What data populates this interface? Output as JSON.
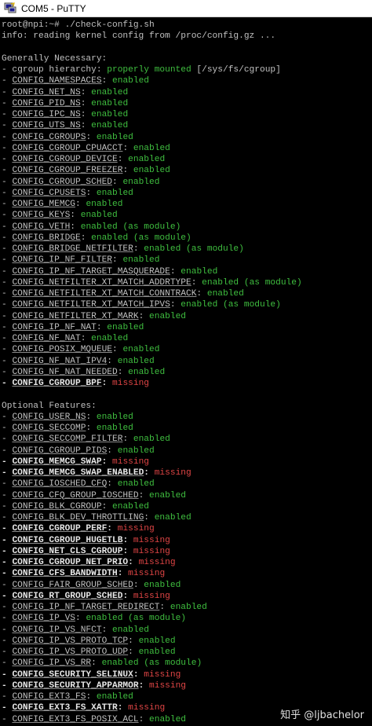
{
  "window": {
    "title": "COM5 - PuTTY",
    "icon": "putty-icon"
  },
  "terminal": {
    "colors": {
      "background": "#000000",
      "text": "#c0c0c0",
      "enabled": "#3fbf3f",
      "missing": "#e04545"
    },
    "lines": [
      {
        "text": "root@npi:~# ./check-config.sh"
      },
      {
        "text": "info: reading kernel config from /proc/config.gz ..."
      },
      {
        "text": ""
      },
      {
        "text": "Generally Necessary:"
      },
      {
        "prefix": "- cgroup hierarchy: ",
        "status": "properly mounted",
        "suffix": " [/sys/fs/cgroup]",
        "state": "ok"
      },
      {
        "prefix": "- ",
        "name": "CONFIG_NAMESPACES",
        "sep": ": ",
        "status": "enabled",
        "state": "ok"
      },
      {
        "prefix": "- ",
        "name": "CONFIG_NET_NS",
        "sep": ": ",
        "status": "enabled",
        "state": "ok"
      },
      {
        "prefix": "- ",
        "name": "CONFIG_PID_NS",
        "sep": ": ",
        "status": "enabled",
        "state": "ok"
      },
      {
        "prefix": "- ",
        "name": "CONFIG_IPC_NS",
        "sep": ": ",
        "status": "enabled",
        "state": "ok"
      },
      {
        "prefix": "- ",
        "name": "CONFIG_UTS_NS",
        "sep": ": ",
        "status": "enabled",
        "state": "ok"
      },
      {
        "prefix": "- ",
        "name": "CONFIG_CGROUPS",
        "sep": ": ",
        "status": "enabled",
        "state": "ok"
      },
      {
        "prefix": "- ",
        "name": "CONFIG_CGROUP_CPUACCT",
        "sep": ": ",
        "status": "enabled",
        "state": "ok"
      },
      {
        "prefix": "- ",
        "name": "CONFIG_CGROUP_DEVICE",
        "sep": ": ",
        "status": "enabled",
        "state": "ok"
      },
      {
        "prefix": "- ",
        "name": "CONFIG_CGROUP_FREEZER",
        "sep": ": ",
        "status": "enabled",
        "state": "ok"
      },
      {
        "prefix": "- ",
        "name": "CONFIG_CGROUP_SCHED",
        "sep": ": ",
        "status": "enabled",
        "state": "ok"
      },
      {
        "prefix": "- ",
        "name": "CONFIG_CPUSETS",
        "sep": ": ",
        "status": "enabled",
        "state": "ok"
      },
      {
        "prefix": "- ",
        "name": "CONFIG_MEMCG",
        "sep": ": ",
        "status": "enabled",
        "state": "ok"
      },
      {
        "prefix": "- ",
        "name": "CONFIG_KEYS",
        "sep": ": ",
        "status": "enabled",
        "state": "ok"
      },
      {
        "prefix": "- ",
        "name": "CONFIG_VETH",
        "sep": ": ",
        "status": "enabled (as module)",
        "state": "ok"
      },
      {
        "prefix": "- ",
        "name": "CONFIG_BRIDGE",
        "sep": ": ",
        "status": "enabled (as module)",
        "state": "ok"
      },
      {
        "prefix": "- ",
        "name": "CONFIG_BRIDGE_NETFILTER",
        "sep": ": ",
        "status": "enabled (as module)",
        "state": "ok"
      },
      {
        "prefix": "- ",
        "name": "CONFIG_IP_NF_FILTER",
        "sep": ": ",
        "status": "enabled",
        "state": "ok"
      },
      {
        "prefix": "- ",
        "name": "CONFIG_IP_NF_TARGET_MASQUERADE",
        "sep": ": ",
        "status": "enabled",
        "state": "ok"
      },
      {
        "prefix": "- ",
        "name": "CONFIG_NETFILTER_XT_MATCH_ADDRTYPE",
        "sep": ": ",
        "status": "enabled (as module)",
        "state": "ok"
      },
      {
        "prefix": "- ",
        "name": "CONFIG_NETFILTER_XT_MATCH_CONNTRACK",
        "sep": ": ",
        "status": "enabled",
        "state": "ok"
      },
      {
        "prefix": "- ",
        "name": "CONFIG_NETFILTER_XT_MATCH_IPVS",
        "sep": ": ",
        "status": "enabled (as module)",
        "state": "ok"
      },
      {
        "prefix": "- ",
        "name": "CONFIG_NETFILTER_XT_MARK",
        "sep": ": ",
        "status": "enabled",
        "state": "ok"
      },
      {
        "prefix": "- ",
        "name": "CONFIG_IP_NF_NAT",
        "sep": ": ",
        "status": "enabled",
        "state": "ok"
      },
      {
        "prefix": "- ",
        "name": "CONFIG_NF_NAT",
        "sep": ": ",
        "status": "enabled",
        "state": "ok"
      },
      {
        "prefix": "- ",
        "name": "CONFIG_POSIX_MQUEUE",
        "sep": ": ",
        "status": "enabled",
        "state": "ok"
      },
      {
        "prefix": "- ",
        "name": "CONFIG_NF_NAT_IPV4",
        "sep": ": ",
        "status": "enabled",
        "state": "ok"
      },
      {
        "prefix": "- ",
        "name": "CONFIG_NF_NAT_NEEDED",
        "sep": ": ",
        "status": "enabled",
        "state": "ok"
      },
      {
        "prefix": "- ",
        "name": "CONFIG_CGROUP_BPF",
        "sep": ": ",
        "status": "missing",
        "state": "missing"
      },
      {
        "text": ""
      },
      {
        "text": "Optional Features:"
      },
      {
        "prefix": "- ",
        "name": "CONFIG_USER_NS",
        "sep": ": ",
        "status": "enabled",
        "state": "ok"
      },
      {
        "prefix": "- ",
        "name": "CONFIG_SECCOMP",
        "sep": ": ",
        "status": "enabled",
        "state": "ok"
      },
      {
        "prefix": "- ",
        "name": "CONFIG_SECCOMP_FILTER",
        "sep": ": ",
        "status": "enabled",
        "state": "ok"
      },
      {
        "prefix": "- ",
        "name": "CONFIG_CGROUP_PIDS",
        "sep": ": ",
        "status": "enabled",
        "state": "ok"
      },
      {
        "prefix": "- ",
        "name": "CONFIG_MEMCG_SWAP",
        "sep": ": ",
        "status": "missing",
        "state": "missing"
      },
      {
        "prefix": "- ",
        "name": "CONFIG_MEMCG_SWAP_ENABLED",
        "sep": ": ",
        "status": "missing",
        "state": "missing"
      },
      {
        "prefix": "- ",
        "name": "CONFIG_IOSCHED_CFQ",
        "sep": ": ",
        "status": "enabled",
        "state": "ok"
      },
      {
        "prefix": "- ",
        "name": "CONFIG_CFQ_GROUP_IOSCHED",
        "sep": ": ",
        "status": "enabled",
        "state": "ok"
      },
      {
        "prefix": "- ",
        "name": "CONFIG_BLK_CGROUP",
        "sep": ": ",
        "status": "enabled",
        "state": "ok"
      },
      {
        "prefix": "- ",
        "name": "CONFIG_BLK_DEV_THROTTLING",
        "sep": ": ",
        "status": "enabled",
        "state": "ok"
      },
      {
        "prefix": "- ",
        "name": "CONFIG_CGROUP_PERF",
        "sep": ": ",
        "status": "missing",
        "state": "missing"
      },
      {
        "prefix": "- ",
        "name": "CONFIG_CGROUP_HUGETLB",
        "sep": ": ",
        "status": "missing",
        "state": "missing"
      },
      {
        "prefix": "- ",
        "name": "CONFIG_NET_CLS_CGROUP",
        "sep": ": ",
        "status": "missing",
        "state": "missing"
      },
      {
        "prefix": "- ",
        "name": "CONFIG_CGROUP_NET_PRIO",
        "sep": ": ",
        "status": "missing",
        "state": "missing"
      },
      {
        "prefix": "- ",
        "name": "CONFIG_CFS_BANDWIDTH",
        "sep": ": ",
        "status": "missing",
        "state": "missing"
      },
      {
        "prefix": "- ",
        "name": "CONFIG_FAIR_GROUP_SCHED",
        "sep": ": ",
        "status": "enabled",
        "state": "ok"
      },
      {
        "prefix": "- ",
        "name": "CONFIG_RT_GROUP_SCHED",
        "sep": ": ",
        "status": "missing",
        "state": "missing"
      },
      {
        "prefix": "- ",
        "name": "CONFIG_IP_NF_TARGET_REDIRECT",
        "sep": ": ",
        "status": "enabled",
        "state": "ok"
      },
      {
        "prefix": "- ",
        "name": "CONFIG_IP_VS",
        "sep": ": ",
        "status": "enabled (as module)",
        "state": "ok"
      },
      {
        "prefix": "- ",
        "name": "CONFIG_IP_VS_NFCT",
        "sep": ": ",
        "status": "enabled",
        "state": "ok"
      },
      {
        "prefix": "- ",
        "name": "CONFIG_IP_VS_PROTO_TCP",
        "sep": ": ",
        "status": "enabled",
        "state": "ok"
      },
      {
        "prefix": "- ",
        "name": "CONFIG_IP_VS_PROTO_UDP",
        "sep": ": ",
        "status": "enabled",
        "state": "ok"
      },
      {
        "prefix": "- ",
        "name": "CONFIG_IP_VS_RR",
        "sep": ": ",
        "status": "enabled (as module)",
        "state": "ok"
      },
      {
        "prefix": "- ",
        "name": "CONFIG_SECURITY_SELINUX",
        "sep": ": ",
        "status": "missing",
        "state": "missing"
      },
      {
        "prefix": "- ",
        "name": "CONFIG_SECURITY_APPARMOR",
        "sep": ": ",
        "status": "missing",
        "state": "missing"
      },
      {
        "prefix": "- ",
        "name": "CONFIG_EXT3_FS",
        "sep": ": ",
        "status": "enabled",
        "state": "ok"
      },
      {
        "prefix": "- ",
        "name": "CONFIG_EXT3_FS_XATTR",
        "sep": ": ",
        "status": "missing",
        "state": "missing"
      },
      {
        "prefix": "- ",
        "name": "CONFIG_EXT3_FS_POSIX_ACL",
        "sep": ": ",
        "status": "enabled",
        "state": "ok"
      }
    ]
  },
  "watermark": "知乎 @ljbachelor"
}
